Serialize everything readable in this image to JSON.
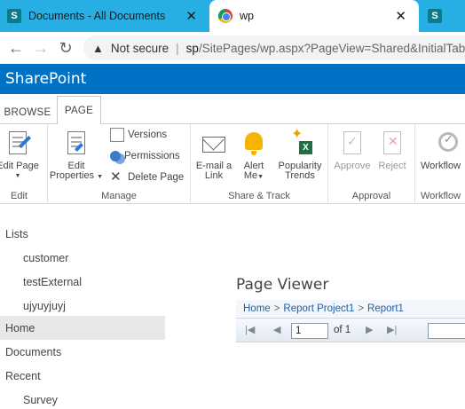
{
  "browser": {
    "tabs": [
      {
        "title": "Documents - All Documents",
        "favicon": "sharepoint-icon"
      },
      {
        "title": "wp",
        "favicon": "chrome-icon"
      },
      {
        "title": "",
        "favicon": "sharepoint-icon"
      }
    ],
    "close_glyph": "✕",
    "security_label": "Not secure",
    "separator": "|",
    "url_host": "sp",
    "url_path": "/SitePages/wp.aspx?PageView=Shared&InitialTab"
  },
  "suitebar": {
    "brand": "SharePoint"
  },
  "ribbon": {
    "tabs": [
      "BROWSE",
      "PAGE"
    ],
    "groups": {
      "edit": {
        "label": "Edit",
        "edit_page": "Edit Page"
      },
      "manage": {
        "label": "Manage",
        "edit_properties_1": "Edit",
        "edit_properties_2": "Properties",
        "versions": "Versions",
        "permissions": "Permissions",
        "delete_page": "Delete Page"
      },
      "share_track": {
        "label": "Share & Track",
        "email_1": "E-mail a",
        "email_2": "Link",
        "alert_1": "Alert",
        "alert_2": "Me",
        "popularity_1": "Popularity",
        "popularity_2": "Trends"
      },
      "approval": {
        "label": "Approval",
        "approve": "Approve",
        "reject": "Reject"
      },
      "workflow": {
        "label": "Workflow",
        "workflows": "Workflow"
      }
    }
  },
  "leftnav": {
    "items": [
      {
        "label": "Lists",
        "level": 1
      },
      {
        "label": "customer",
        "level": 2
      },
      {
        "label": "testExternal",
        "level": 2
      },
      {
        "label": "ujyuyjuyj",
        "level": 2
      },
      {
        "label": "Home",
        "level": 1,
        "selected": true
      },
      {
        "label": "Documents",
        "level": 1
      },
      {
        "label": "Recent",
        "level": 1
      },
      {
        "label": "Survey",
        "level": 2
      }
    ]
  },
  "main": {
    "title": "Page Viewer",
    "breadcrumb": [
      "Home",
      "Report Project1",
      "Report1"
    ],
    "breadcrumb_separator": ">",
    "pager": {
      "current_page": "1",
      "of_text": "of 1"
    }
  },
  "colors": {
    "tabstrip": "#27aee2",
    "suitebar": "#0072c6",
    "link": "#1f5fa8"
  }
}
